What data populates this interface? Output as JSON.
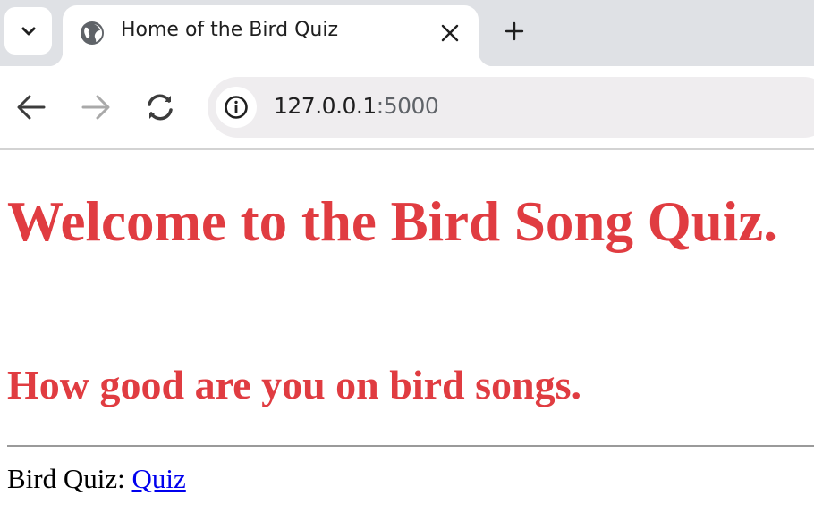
{
  "browser": {
    "tab": {
      "title": "Home of the Bird Quiz",
      "favicon": "globe-icon"
    },
    "tab_menu_icon": "chevron-down-icon",
    "close_icon": "close-icon",
    "new_tab_icon": "plus-icon",
    "nav": {
      "back_icon": "arrow-left-icon",
      "forward_icon": "arrow-right-icon",
      "reload_icon": "reload-icon"
    },
    "address": {
      "site_info_icon": "info-icon",
      "host": "127.0.0.1",
      "port": ":5000"
    }
  },
  "page": {
    "heading": "Welcome to the Bird Song Quiz.",
    "subheading": "How good are you on bird songs.",
    "quiz_label": "Bird Quiz: ",
    "quiz_link": "Quiz",
    "accent_color": "#e03c41",
    "link_color": "#0000ee"
  }
}
